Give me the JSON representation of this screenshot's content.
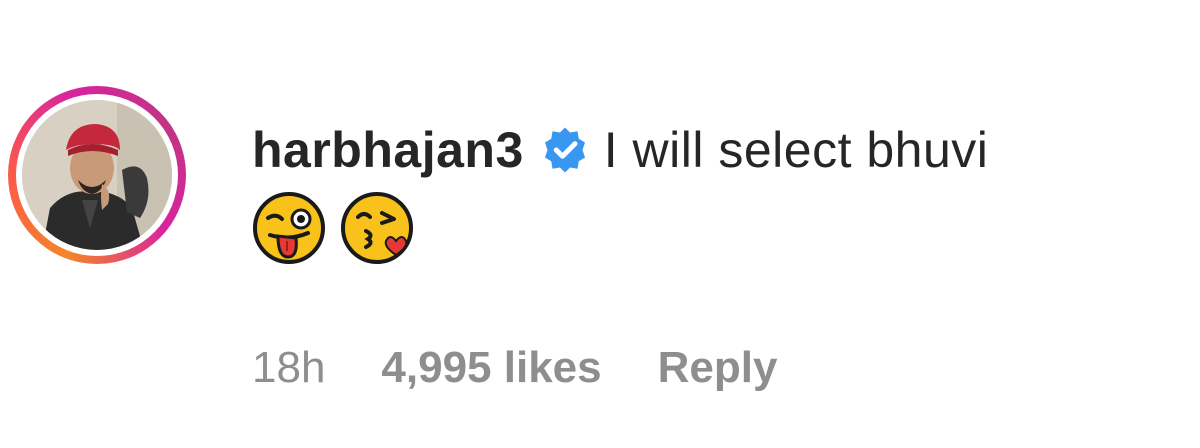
{
  "comment": {
    "username": "harbhajan3",
    "verified_icon": "verified-badge-icon",
    "text": "I will select bhuvi",
    "emojis": [
      "winking-face-with-tongue-icon",
      "face-blowing-kiss-icon"
    ],
    "time": "18h",
    "likes": "4,995 likes",
    "reply_label": "Reply"
  },
  "colors": {
    "text_primary": "#262626",
    "text_secondary": "#8e8e8e",
    "verified_blue": "#3897f0",
    "story_ring": [
      "#f58529",
      "#dd2a7b",
      "#c13584"
    ]
  }
}
